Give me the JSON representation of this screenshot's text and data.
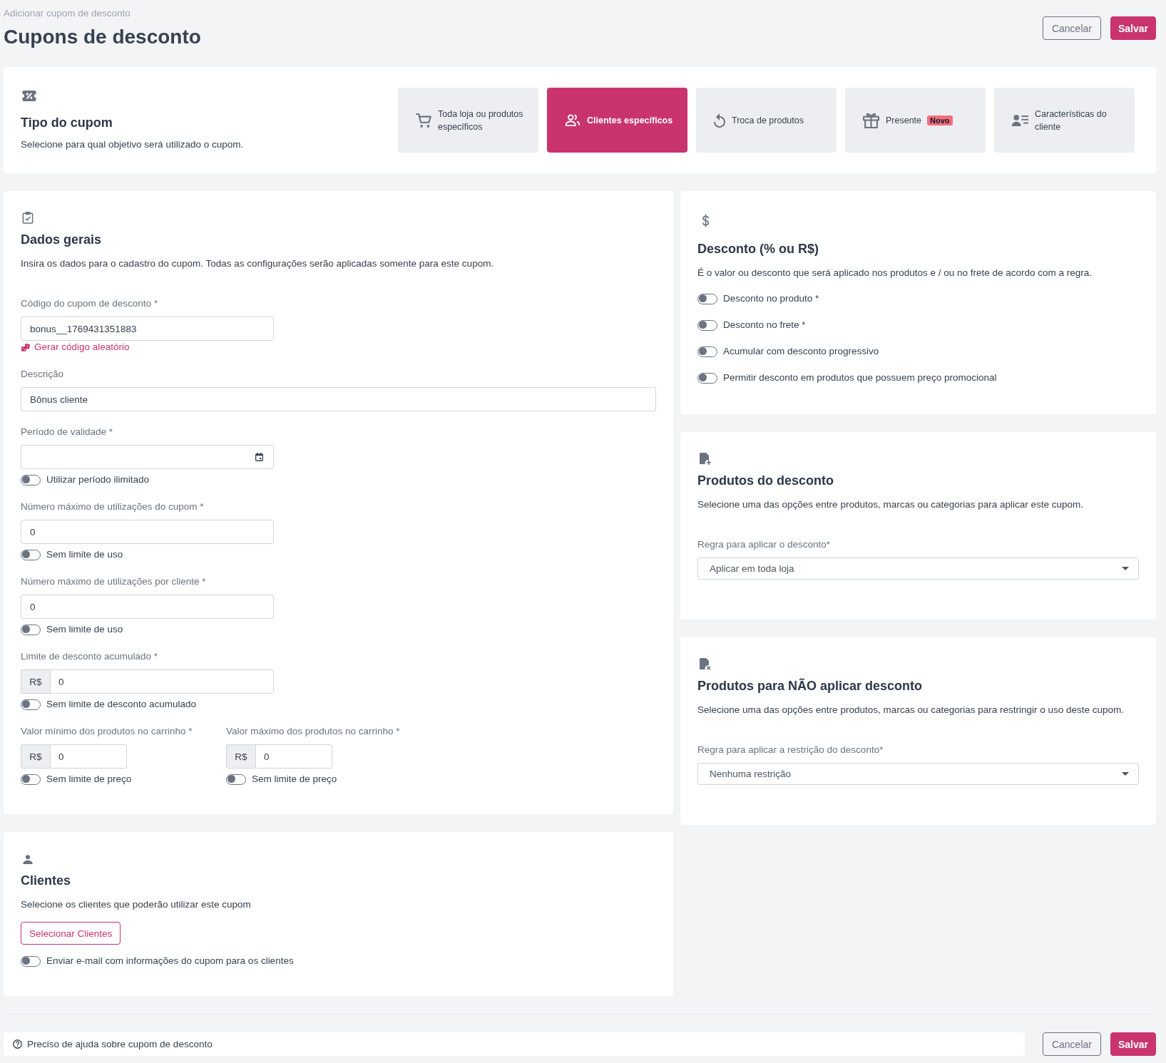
{
  "header": {
    "breadcrumb": "Adicionar cupom de desconto",
    "title": "Cupons de desconto",
    "buttons": [
      {
        "label": "Cancelar",
        "kind": "secondary"
      },
      {
        "label": "Salvar",
        "kind": "primary"
      }
    ]
  },
  "coupon_type": {
    "title": "Tipo do cupom",
    "description": "Selecione para qual objetivo será utilizado o cupom.",
    "options": [
      {
        "label": "Toda loja ou produtos específicos",
        "selected": false
      },
      {
        "label": "Clientes específicos",
        "selected": true
      },
      {
        "label": "Troca de produtos",
        "selected": false
      },
      {
        "label": "Presente",
        "badge": "Novo",
        "selected": false
      },
      {
        "label": "Características do cliente",
        "selected": false
      }
    ]
  },
  "general_data": {
    "title": "Dados gerais",
    "description": "Insira os dados para o cadastro do cupom. Todas as configurações serão aplicadas somente para este cupom.",
    "fields": [
      {
        "kind": "code",
        "label": "Código do cupom de desconto *",
        "value": "bonus__1769431351883",
        "link": "Gerar código aleatório"
      },
      {
        "kind": "text",
        "label": "Descrição",
        "value": "Bônus cliente"
      },
      {
        "kind": "date",
        "label": "Período de validade *",
        "toggle": {
          "label": "Utilizar período ilimitado",
          "on": false
        }
      },
      {
        "kind": "number",
        "label": "Número máximo de utilizações do cupom *",
        "value": "0",
        "toggle": {
          "label": "Sem limite de uso",
          "on": false
        }
      },
      {
        "kind": "number",
        "label": "Número máximo de utilizações por cliente *",
        "value": "0",
        "toggle": {
          "label": "Sem limite de uso",
          "on": false
        }
      },
      {
        "kind": "currency",
        "label": "Limite de desconto acumulado *",
        "prefix": "R$",
        "value": "0",
        "toggle": {
          "label": "Sem limite de desconto acumulado",
          "on": false
        }
      }
    ],
    "price_limits": [
      {
        "kind": "currency",
        "label": "Valor mínimo dos produtos no carrinho *",
        "prefix": "R$",
        "value": "0",
        "toggle": {
          "label": "Sem limite de preço",
          "on": false
        }
      },
      {
        "kind": "currency",
        "label": "Valor máximo dos produtos no carrinho *",
        "prefix": "R$",
        "value": "0",
        "toggle": {
          "label": "Sem limite de preço",
          "on": false
        }
      }
    ]
  },
  "discount": {
    "title": "Desconto (% ou R$)",
    "description": "É o valor ou desconto que será aplicado nos produtos e / ou no frete de acordo com a regra.",
    "toggles": [
      {
        "label": "Desconto no produto *",
        "on": false
      },
      {
        "label": "Desconto no frete *",
        "on": false
      },
      {
        "label": "Acumular com desconto progressivo",
        "on": false
      },
      {
        "label": "Permitir desconto em produtos que possuem preço promocional",
        "on": false
      }
    ]
  },
  "discount_products": {
    "title": "Produtos do desconto",
    "description": "Selecione uma das opções entre produtos, marcas ou categorias para aplicar este cupom.",
    "select": {
      "label": "Regra para aplicar o desconto*",
      "value": "Aplicar em toda loja"
    }
  },
  "excluded_products": {
    "title": "Produtos para NÃO aplicar desconto",
    "description": "Selecione uma das opções entre produtos, marcas ou categorias para restringir o uso deste cupom.",
    "select": {
      "label": "Regra para aplicar a restrição do desconto*",
      "value": "Nenhuma restrição"
    }
  },
  "customers": {
    "title": "Clientes",
    "description": "Selecione os clientes que poderão utilizar este cupom",
    "button": "Selecionar Clientes",
    "toggle": {
      "label": "Enviar e-mail com informações do cupom para os clientes",
      "on": false
    }
  },
  "footer": {
    "help": "Preciso de ajuda sobre cupom de desconto",
    "buttons": [
      {
        "label": "Cancelar",
        "kind": "secondary"
      },
      {
        "label": "Salvar",
        "kind": "primary"
      }
    ]
  }
}
